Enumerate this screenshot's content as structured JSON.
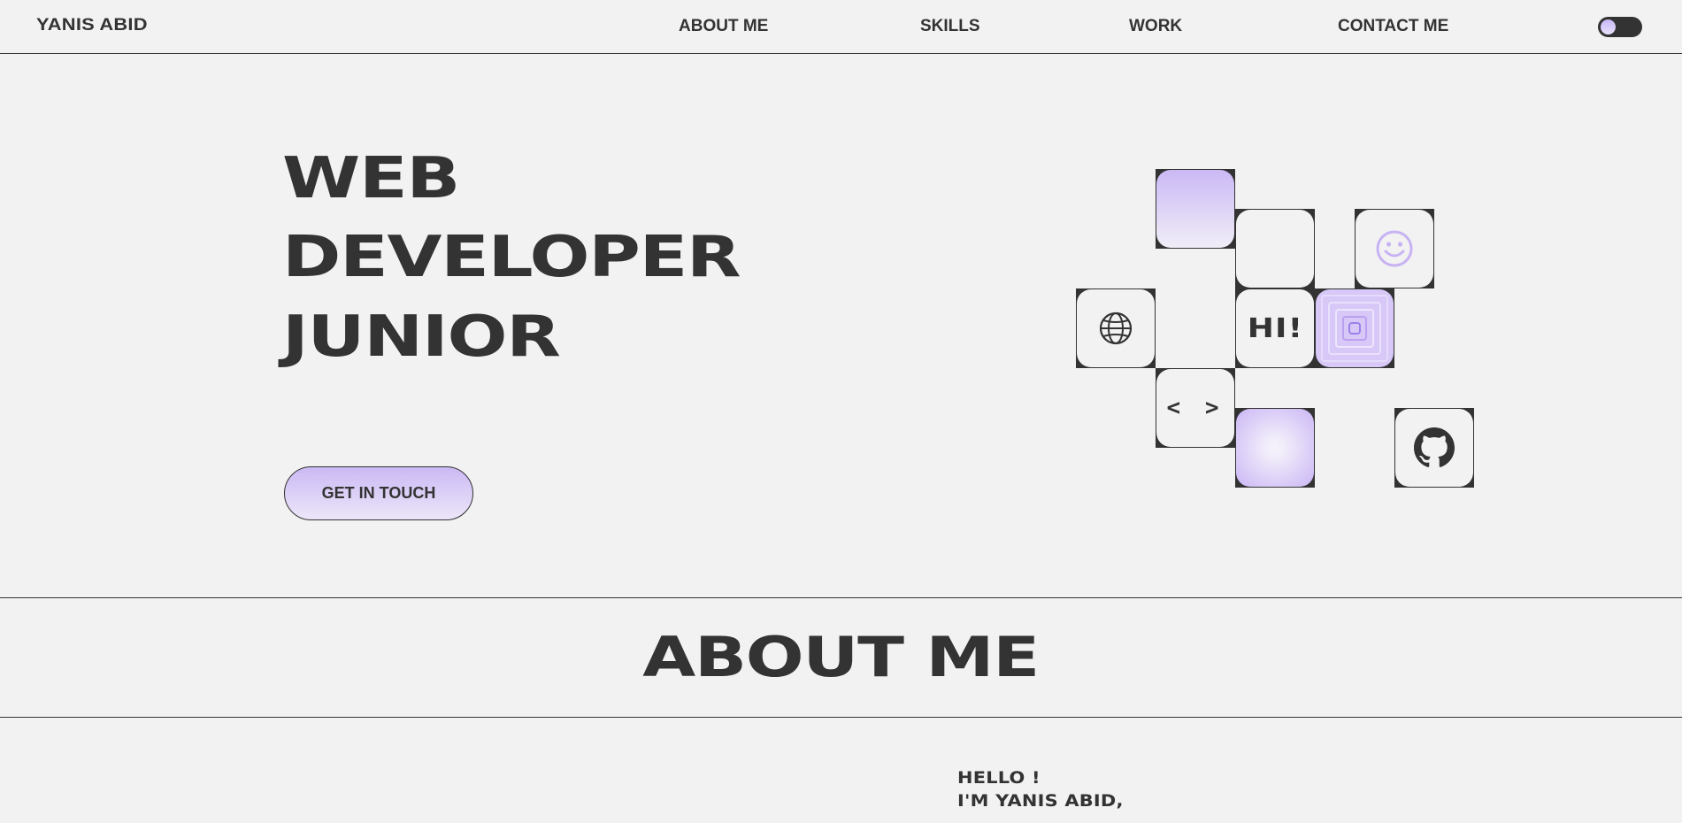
{
  "nav": {
    "logo": "YANIS ABID",
    "links": [
      "ABOUT ME",
      "SKILLS",
      "WORK",
      "CONTACT ME"
    ],
    "theme_toggle": "theme-toggle"
  },
  "hero": {
    "lines": [
      "WEB",
      "DEVELOPER",
      "JUNIOR"
    ],
    "cta_label": "GET IN TOUCH"
  },
  "tiles": {
    "hi_label": "HI!",
    "code_label": "< >",
    "icons": [
      "globe-icon",
      "smiley-icon",
      "github-icon"
    ]
  },
  "about": {
    "title": "ABOUT ME",
    "greeting": "HELLO !",
    "intro": "I'M YANIS ABID,"
  },
  "colors": {
    "background": "#f2f2f2",
    "text": "#333333",
    "accent": "#cbb9f5"
  }
}
